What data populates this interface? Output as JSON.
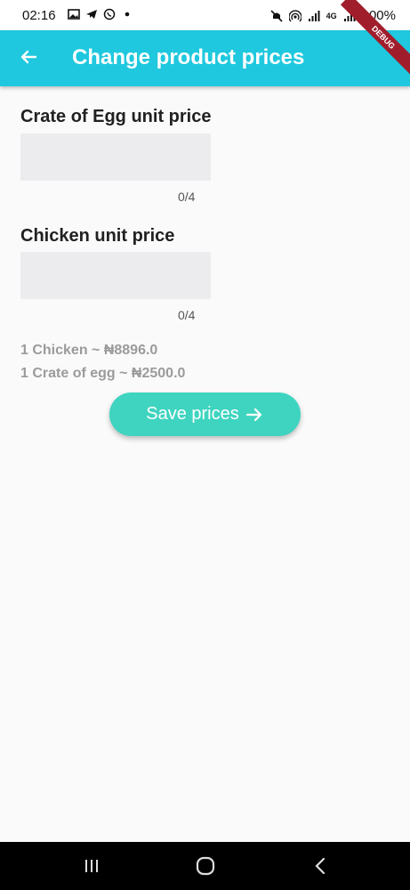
{
  "status_bar": {
    "time": "02:16",
    "battery": "100%",
    "network_label": "4G",
    "left_icons": [
      "image-icon",
      "telegram-icon",
      "whatsapp-icon",
      "dot-icon"
    ],
    "right_icons": [
      "mute-icon",
      "hotspot-icon",
      "signal-icon",
      "signal-icon",
      "battery-icon"
    ]
  },
  "debug_banner": "DEBUG",
  "app_bar": {
    "back_icon": "arrow-back-icon",
    "title": "Change product prices"
  },
  "form": {
    "egg_label": "Crate of Egg unit price",
    "egg_value": "",
    "egg_counter": "0/4",
    "chicken_label": "Chicken unit price",
    "chicken_value": "",
    "chicken_counter": "0/4"
  },
  "info": {
    "chicken_line": "1 Chicken ~ ₦8896.0",
    "egg_line": "1 Crate of egg ~ ₦2500.0"
  },
  "save_button": {
    "label": "Save prices",
    "icon": "arrow-forward-icon"
  },
  "nav_bar": {
    "buttons": [
      "recent-apps-icon",
      "home-icon",
      "back-icon"
    ]
  },
  "colors": {
    "app_bar": "#1fc8de",
    "save_button": "#3fd4c0",
    "field_bg": "#ececef",
    "debug_banner": "#a01d2c"
  }
}
